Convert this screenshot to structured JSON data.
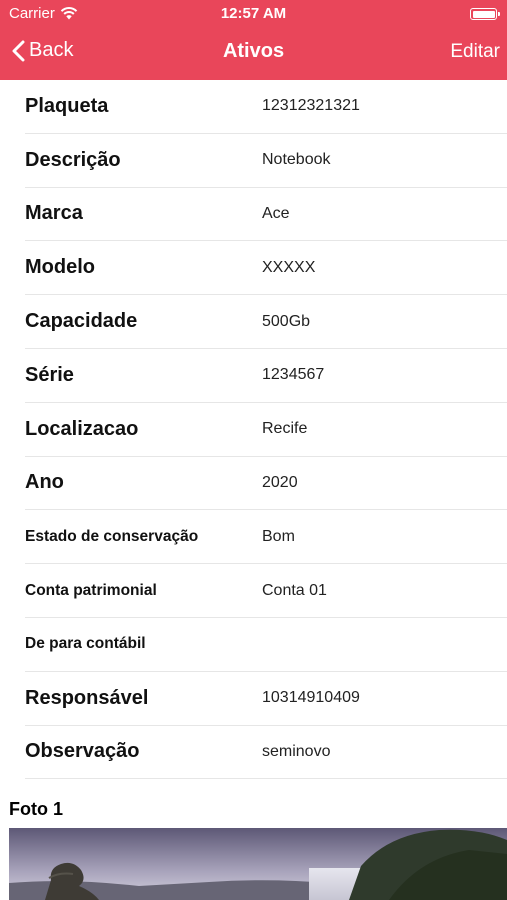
{
  "status_bar": {
    "carrier": "Carrier",
    "time": "12:57 AM"
  },
  "nav": {
    "back_label": "Back",
    "title": "Ativos",
    "edit_label": "Editar"
  },
  "rows": [
    {
      "label": "Plaqueta",
      "value": "12312321321"
    },
    {
      "label": "Descrição",
      "value": "Notebook"
    },
    {
      "label": "Marca",
      "value": "Ace"
    },
    {
      "label": "Modelo",
      "value": "XXXXX"
    },
    {
      "label": "Capacidade",
      "value": "500Gb"
    },
    {
      "label": "Série",
      "value": "1234567"
    },
    {
      "label": "Localizacao",
      "value": "Recife"
    },
    {
      "label": "Ano",
      "value": "2020"
    },
    {
      "label": "Estado de conservação",
      "value": "Bom"
    },
    {
      "label": "Conta patrimonial",
      "value": "Conta 01"
    },
    {
      "label": "De para contábil",
      "value": ""
    },
    {
      "label": "Responsável",
      "value": "10314910409"
    },
    {
      "label": "Observação",
      "value": "seminovo"
    }
  ],
  "photos": {
    "foto1_title": "Foto 1"
  },
  "colors": {
    "brand": "#e9465a"
  }
}
